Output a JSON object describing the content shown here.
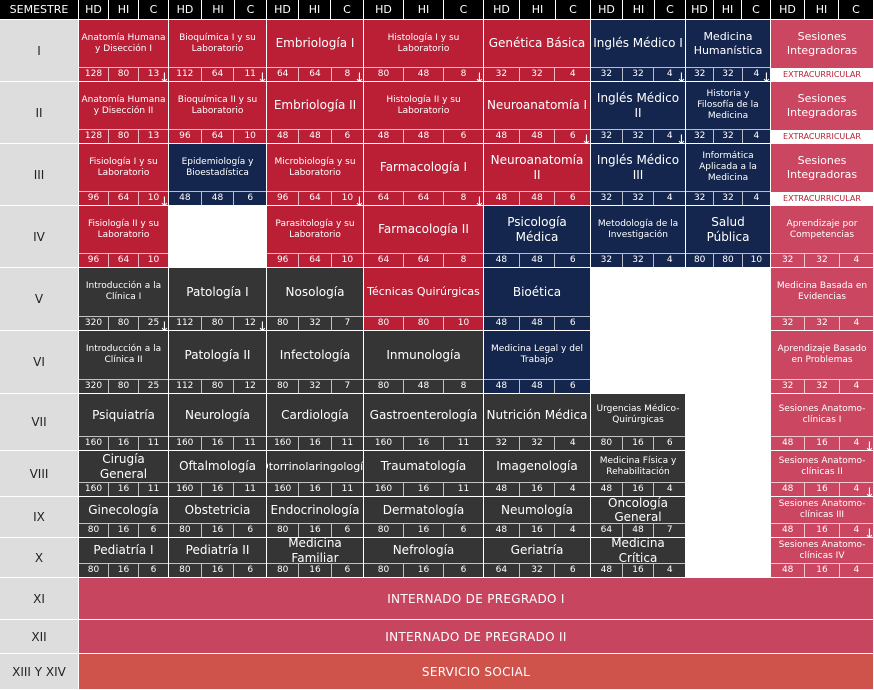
{
  "header": {
    "semester_label": "SEMESTRE",
    "columns": [
      "HD",
      "HI",
      "C"
    ]
  },
  "semesters": [
    "I",
    "II",
    "III",
    "IV",
    "V",
    "VI",
    "VII",
    "VIII",
    "IX",
    "X",
    "XI",
    "XII",
    "XIII Y XIV"
  ],
  "colors": {
    "red": "#ba1f36",
    "navy": "#14264d",
    "dark": "#353535",
    "pink": "#cb4660",
    "internado": "#c84560",
    "servicio": "#d0534b",
    "semester_bg": "#dddddd"
  },
  "extracurricular_label": "EXTRACURRICULAR",
  "courses": [
    {
      "c": 0,
      "r": 0,
      "rs": 1,
      "t": "Anatomía Humana y Disección I",
      "v": [
        "128",
        "80",
        "13"
      ],
      "k": "red",
      "a": 1
    },
    {
      "c": 1,
      "r": 0,
      "rs": 1,
      "t": "Bioquímica I y su Laboratorio",
      "v": [
        "112",
        "64",
        "11"
      ],
      "k": "red",
      "a": 1
    },
    {
      "c": 2,
      "r": 0,
      "rs": 1,
      "t": "Embriología I",
      "v": [
        "64",
        "64",
        "8"
      ],
      "k": "red",
      "a": 1
    },
    {
      "c": 3,
      "r": 0,
      "rs": 1,
      "t": "Histología I y su Laboratorio",
      "v": [
        "80",
        "48",
        "8"
      ],
      "k": "red",
      "a": 1
    },
    {
      "c": 4,
      "r": 0,
      "rs": 1,
      "t": "Genética Básica",
      "v": [
        "32",
        "32",
        "4"
      ],
      "k": "red"
    },
    {
      "c": 5,
      "r": 0,
      "rs": 1,
      "t": "Inglés Médico I",
      "v": [
        "32",
        "32",
        "4"
      ],
      "k": "navy",
      "a": 1
    },
    {
      "c": 6,
      "r": 0,
      "rs": 1,
      "t": "Medicina Humanística",
      "v": [
        "32",
        "32",
        "4"
      ],
      "k": "navy",
      "a": 1
    },
    {
      "c": 7,
      "r": 0,
      "rs": 1,
      "t": "Sesiones Integradoras",
      "k": "pink",
      "extra": 1
    },
    {
      "c": 0,
      "r": 1,
      "rs": 1,
      "t": "Anatomía Humana y Disección II",
      "v": [
        "128",
        "80",
        "13"
      ],
      "k": "red"
    },
    {
      "c": 1,
      "r": 1,
      "rs": 1,
      "t": "Bioquímica II y su Laboratorio",
      "v": [
        "96",
        "64",
        "10"
      ],
      "k": "red"
    },
    {
      "c": 2,
      "r": 1,
      "rs": 1,
      "t": "Embriología II",
      "v": [
        "48",
        "48",
        "6"
      ],
      "k": "red"
    },
    {
      "c": 3,
      "r": 1,
      "rs": 1,
      "t": "Histología II y su Laboratorio",
      "v": [
        "48",
        "48",
        "6"
      ],
      "k": "red"
    },
    {
      "c": 4,
      "r": 1,
      "rs": 1,
      "t": "Neuroanatomía I",
      "v": [
        "48",
        "48",
        "6"
      ],
      "k": "red",
      "a": 1
    },
    {
      "c": 5,
      "r": 1,
      "rs": 1,
      "t": "Inglés Médico II",
      "v": [
        "32",
        "32",
        "4"
      ],
      "k": "navy",
      "a": 1
    },
    {
      "c": 6,
      "r": 1,
      "rs": 1,
      "t": "Historia y Filosofía de la Medicina",
      "v": [
        "32",
        "32",
        "4"
      ],
      "k": "navy"
    },
    {
      "c": 7,
      "r": 1,
      "rs": 1,
      "t": "Sesiones Integradoras",
      "k": "pink",
      "extra": 1
    },
    {
      "c": 0,
      "r": 2,
      "rs": 1,
      "t": "Fisiología I y su Laboratorio",
      "v": [
        "96",
        "64",
        "10"
      ],
      "k": "red",
      "a": 1
    },
    {
      "c": 1,
      "r": 2,
      "rs": 1,
      "t": "Epidemiología y Bioestadística",
      "v": [
        "48",
        "48",
        "6"
      ],
      "k": "navy"
    },
    {
      "c": 2,
      "r": 2,
      "rs": 1,
      "t": "Microbiología y su Laboratorio",
      "v": [
        "96",
        "64",
        "10"
      ],
      "k": "red",
      "a": 1
    },
    {
      "c": 3,
      "r": 2,
      "rs": 1,
      "t": "Farmacología I",
      "v": [
        "64",
        "64",
        "8"
      ],
      "k": "red",
      "a": 1
    },
    {
      "c": 4,
      "r": 2,
      "rs": 1,
      "t": "Neuroanatomía II",
      "v": [
        "48",
        "48",
        "6"
      ],
      "k": "red"
    },
    {
      "c": 5,
      "r": 2,
      "rs": 1,
      "t": "Inglés Médico III",
      "v": [
        "32",
        "32",
        "4"
      ],
      "k": "navy"
    },
    {
      "c": 6,
      "r": 2,
      "rs": 1,
      "t": "Informática Aplicada a la Medicina",
      "v": [
        "32",
        "32",
        "4"
      ],
      "k": "navy"
    },
    {
      "c": 7,
      "r": 2,
      "rs": 1,
      "t": "Sesiones Integradoras",
      "k": "pink",
      "extra": 1
    },
    {
      "c": 0,
      "r": 3,
      "rs": 1,
      "t": "Fisiología II y su Laboratorio",
      "v": [
        "96",
        "64",
        "10"
      ],
      "k": "red"
    },
    {
      "c": 2,
      "r": 3,
      "rs": 1,
      "t": "Parasitología y su Laboratorio",
      "v": [
        "96",
        "64",
        "10"
      ],
      "k": "red"
    },
    {
      "c": 3,
      "r": 3,
      "rs": 1,
      "t": "Farmacología II",
      "v": [
        "64",
        "64",
        "8"
      ],
      "k": "red"
    },
    {
      "c": 4,
      "r": 3,
      "rs": 1,
      "t": "Psicología Médica",
      "v": [
        "48",
        "48",
        "6"
      ],
      "k": "navy"
    },
    {
      "c": 5,
      "r": 3,
      "rs": 1,
      "t": "Metodología de la Investigación",
      "v": [
        "32",
        "32",
        "4"
      ],
      "k": "navy"
    },
    {
      "c": 6,
      "r": 3,
      "rs": 1,
      "t": "Salud Pública",
      "v": [
        "80",
        "80",
        "10"
      ],
      "k": "navy"
    },
    {
      "c": 7,
      "r": 3,
      "rs": 1,
      "t": "Aprendizaje por Competencias",
      "v": [
        "32",
        "32",
        "4"
      ],
      "k": "pink"
    },
    {
      "c": 0,
      "r": 4,
      "rs": 1,
      "t": "Introducción a la Clínica I",
      "v": [
        "320",
        "80",
        "25"
      ],
      "k": "dark",
      "a": 1
    },
    {
      "c": 1,
      "r": 4,
      "rs": 1,
      "t": "Patología I",
      "v": [
        "112",
        "80",
        "12"
      ],
      "k": "dark",
      "a": 1
    },
    {
      "c": 2,
      "r": 4,
      "rs": 1,
      "t": "Nosología",
      "v": [
        "80",
        "32",
        "7"
      ],
      "k": "dark"
    },
    {
      "c": 3,
      "r": 4,
      "rs": 1,
      "t": "Técnicas Quirúrgicas",
      "v": [
        "80",
        "80",
        "10"
      ],
      "k": "red"
    },
    {
      "c": 4,
      "r": 4,
      "rs": 1,
      "t": "Bioética",
      "v": [
        "48",
        "48",
        "6"
      ],
      "k": "navy"
    },
    {
      "c": 7,
      "r": 4,
      "rs": 1,
      "t": "Medicina Basada en Evidencias",
      "v": [
        "32",
        "32",
        "4"
      ],
      "k": "pink"
    },
    {
      "c": 0,
      "r": 5,
      "rs": 1,
      "t": "Introducción a la Clínica II",
      "v": [
        "320",
        "80",
        "25"
      ],
      "k": "dark"
    },
    {
      "c": 1,
      "r": 5,
      "rs": 1,
      "t": "Patología II",
      "v": [
        "112",
        "80",
        "12"
      ],
      "k": "dark"
    },
    {
      "c": 2,
      "r": 5,
      "rs": 1,
      "t": "Infectología",
      "v": [
        "80",
        "32",
        "7"
      ],
      "k": "dark"
    },
    {
      "c": 3,
      "r": 5,
      "rs": 1,
      "t": "Inmunología",
      "v": [
        "80",
        "48",
        "8"
      ],
      "k": "dark"
    },
    {
      "c": 4,
      "r": 5,
      "rs": 1,
      "t": "Medicina Legal y del Trabajo",
      "v": [
        "48",
        "48",
        "6"
      ],
      "k": "navy"
    },
    {
      "c": 7,
      "r": 5,
      "rs": 1,
      "t": "Aprendizaje Basado en Problemas",
      "v": [
        "32",
        "32",
        "4"
      ],
      "k": "pink"
    },
    {
      "c": 0,
      "r": 6,
      "rs": 1,
      "t": "Psiquiatría",
      "v": [
        "160",
        "16",
        "11"
      ],
      "k": "dark"
    },
    {
      "c": 1,
      "r": 6,
      "rs": 1,
      "t": "Neurología",
      "v": [
        "160",
        "16",
        "11"
      ],
      "k": "dark"
    },
    {
      "c": 2,
      "r": 6,
      "rs": 1,
      "t": "Cardiología",
      "v": [
        "160",
        "16",
        "11"
      ],
      "k": "dark"
    },
    {
      "c": 3,
      "r": 6,
      "rs": 1,
      "t": "Gastroenterología",
      "v": [
        "160",
        "16",
        "11"
      ],
      "k": "dark"
    },
    {
      "c": 4,
      "r": 6,
      "rs": 1,
      "t": "Nutrición Médica",
      "v": [
        "32",
        "32",
        "4"
      ],
      "k": "dark"
    },
    {
      "c": 5,
      "r": 6,
      "rs": 1,
      "t": "Urgencias Médico-Quirúrgicas",
      "v": [
        "80",
        "16",
        "6"
      ],
      "k": "dark"
    },
    {
      "c": 7,
      "r": 6,
      "rs": 1,
      "t": "Sesiones Anatomo-clínicas I",
      "v": [
        "48",
        "16",
        "4"
      ],
      "k": "pink",
      "a": 1
    },
    {
      "c": 0,
      "r": 7,
      "rs": 1,
      "t": "Cirugía General",
      "v": [
        "160",
        "16",
        "11"
      ],
      "k": "dark"
    },
    {
      "c": 1,
      "r": 7,
      "rs": 1,
      "t": "Oftalmología",
      "v": [
        "160",
        "16",
        "11"
      ],
      "k": "dark"
    },
    {
      "c": 2,
      "r": 7,
      "rs": 1,
      "t": "Otorrinolaringología",
      "v": [
        "160",
        "16",
        "11"
      ],
      "k": "dark"
    },
    {
      "c": 3,
      "r": 7,
      "rs": 1,
      "t": "Traumatología",
      "v": [
        "160",
        "16",
        "11"
      ],
      "k": "dark"
    },
    {
      "c": 4,
      "r": 7,
      "rs": 1,
      "t": "Imagenología",
      "v": [
        "48",
        "16",
        "4"
      ],
      "k": "dark"
    },
    {
      "c": 5,
      "r": 7,
      "rs": 1,
      "t": "Medicina Física y Rehabilitación",
      "v": [
        "48",
        "16",
        "4"
      ],
      "k": "dark"
    },
    {
      "c": 7,
      "r": 7,
      "rs": 1,
      "t": "Sesiones Anatomo-clínicas II",
      "v": [
        "48",
        "16",
        "4"
      ],
      "k": "pink",
      "a": 1
    },
    {
      "c": 0,
      "r": 8,
      "rs": 1,
      "t": "Ginecología",
      "v": [
        "80",
        "16",
        "6"
      ],
      "k": "dark"
    },
    {
      "c": 1,
      "r": 8,
      "rs": 1,
      "t": "Obstetricia",
      "v": [
        "80",
        "16",
        "6"
      ],
      "k": "dark"
    },
    {
      "c": 2,
      "r": 8,
      "rs": 1,
      "t": "Endocrinología",
      "v": [
        "80",
        "16",
        "6"
      ],
      "k": "dark"
    },
    {
      "c": 3,
      "r": 8,
      "rs": 1,
      "t": "Dermatología",
      "v": [
        "80",
        "16",
        "6"
      ],
      "k": "dark"
    },
    {
      "c": 4,
      "r": 8,
      "rs": 1,
      "t": "Neumología",
      "v": [
        "48",
        "16",
        "4"
      ],
      "k": "dark"
    },
    {
      "c": 5,
      "r": 8,
      "rs": 1,
      "t": "Oncología General",
      "v": [
        "64",
        "48",
        "7"
      ],
      "k": "dark"
    },
    {
      "c": 7,
      "r": 8,
      "rs": 1,
      "t": "Sesiones Anatomo-clínicas III",
      "v": [
        "48",
        "16",
        "4"
      ],
      "k": "pink",
      "a": 1
    },
    {
      "c": 0,
      "r": 9,
      "rs": 1,
      "t": "Pediatría I",
      "v": [
        "80",
        "16",
        "6"
      ],
      "k": "dark"
    },
    {
      "c": 1,
      "r": 9,
      "rs": 1,
      "t": "Pediatría II",
      "v": [
        "80",
        "16",
        "6"
      ],
      "k": "dark"
    },
    {
      "c": 2,
      "r": 9,
      "rs": 1,
      "t": "Medicina Familiar",
      "v": [
        "80",
        "16",
        "6"
      ],
      "k": "dark"
    },
    {
      "c": 3,
      "r": 9,
      "rs": 1,
      "t": "Nefrología",
      "v": [
        "80",
        "16",
        "6"
      ],
      "k": "dark"
    },
    {
      "c": 4,
      "r": 9,
      "rs": 1,
      "t": "Geriatría",
      "v": [
        "64",
        "32",
        "6"
      ],
      "k": "dark"
    },
    {
      "c": 5,
      "r": 9,
      "rs": 1,
      "t": "Medicina Crítica",
      "v": [
        "48",
        "16",
        "4"
      ],
      "k": "dark"
    },
    {
      "c": 7,
      "r": 9,
      "rs": 1,
      "t": "Sesiones Anatomo-clínicas IV",
      "v": [
        "48",
        "16",
        "4"
      ],
      "k": "pink"
    }
  ],
  "wide_rows": [
    {
      "r": 10,
      "t": "INTERNADO DE PREGRADO I",
      "k": "internado"
    },
    {
      "r": 11,
      "t": "INTERNADO DE PREGRADO II",
      "k": "internado"
    },
    {
      "r": 12,
      "t": "SERVICIO SOCIAL",
      "k": "servicio"
    }
  ]
}
